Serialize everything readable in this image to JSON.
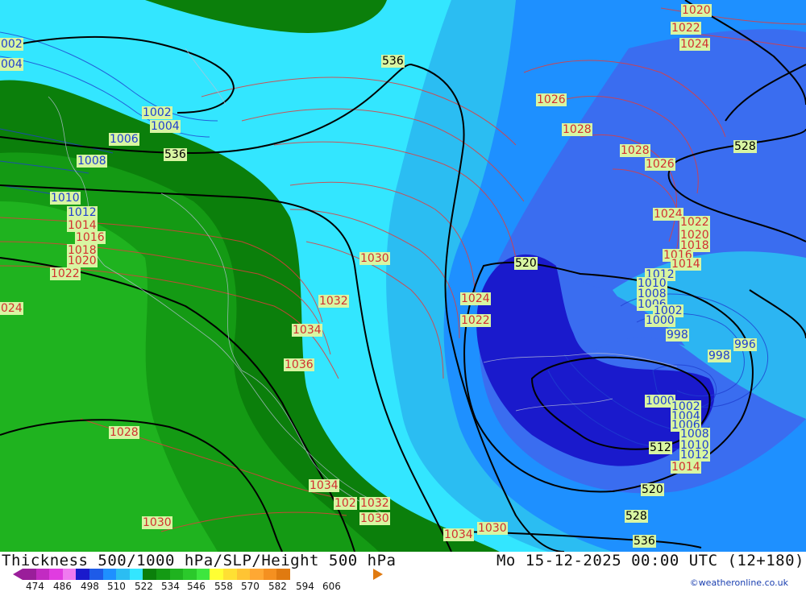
{
  "title": "Thickness 500/1000 hPa/SLP/Height 500 hPa",
  "datetime": "Mo 15-12-2025 00:00 UTC (12+180)",
  "credit": "©weatheronline.co.uk",
  "colors": {
    "band_green_dark": "#0b7f0b",
    "band_green_mid": "#149a14",
    "band_green": "#1fb31f",
    "band_cyan": "#33e6ff",
    "band_sky": "#2bbdf2",
    "band_blue": "#1e90ff",
    "band_mid_blue": "#3a6df0",
    "band_deep_blue": "#1a1acc",
    "slp_high": "#e03c3c",
    "slp_low": "#1f3fd0",
    "height": "#000000",
    "label_fill": "#d8f5a2"
  },
  "scale": {
    "ticks": [
      "474",
      "486",
      "498",
      "510",
      "522",
      "534",
      "546",
      "558",
      "570",
      "582",
      "594",
      "606"
    ],
    "colors": [
      "#9a1e9a",
      "#c22bc2",
      "#e03ce0",
      "#f07af0",
      "#1a1acc",
      "#1e5be8",
      "#1e90ff",
      "#2bbdf2",
      "#33e6ff",
      "#0b7f0b",
      "#149a14",
      "#1fb31f",
      "#2bc92b",
      "#3ee63e",
      "#ffff33",
      "#ffe033",
      "#ffc433",
      "#ffa833",
      "#f59020",
      "#e07a10"
    ]
  },
  "labels": [
    {
      "text": "1020",
      "c": "r"
    },
    {
      "text": "1022",
      "c": "r"
    },
    {
      "text": "1024",
      "c": "r"
    },
    {
      "text": "002",
      "c": "b"
    },
    {
      "text": "004",
      "c": "b"
    },
    {
      "text": "1002",
      "c": "b"
    },
    {
      "text": "1004",
      "c": "b"
    },
    {
      "text": "1006",
      "c": "b"
    },
    {
      "text": "1008",
      "c": "b"
    },
    {
      "text": "536",
      "c": "k"
    },
    {
      "text": "536",
      "c": "k"
    },
    {
      "text": "1026",
      "c": "r"
    },
    {
      "text": "1028",
      "c": "r"
    },
    {
      "text": "1028",
      "c": "r"
    },
    {
      "text": "1026",
      "c": "r"
    },
    {
      "text": "528",
      "c": "k"
    },
    {
      "text": "1010",
      "c": "b"
    },
    {
      "text": "1012",
      "c": "b"
    },
    {
      "text": "1014",
      "c": "r"
    },
    {
      "text": "1016",
      "c": "r"
    },
    {
      "text": "1018",
      "c": "r"
    },
    {
      "text": "1020",
      "c": "r"
    },
    {
      "text": "1022",
      "c": "r"
    },
    {
      "text": "1024",
      "c": "r"
    },
    {
      "text": "1022",
      "c": "r"
    },
    {
      "text": "1020",
      "c": "r"
    },
    {
      "text": "1018",
      "c": "r"
    },
    {
      "text": "1016",
      "c": "r"
    },
    {
      "text": "1014",
      "c": "r"
    },
    {
      "text": "1030",
      "c": "r"
    },
    {
      "text": "520",
      "c": "k"
    },
    {
      "text": "1012",
      "c": "b"
    },
    {
      "text": "1010",
      "c": "b"
    },
    {
      "text": "1008",
      "c": "b"
    },
    {
      "text": "1006",
      "c": "b"
    },
    {
      "text": "1032",
      "c": "r"
    },
    {
      "text": "1024",
      "c": "r"
    },
    {
      "text": "1002",
      "c": "b"
    },
    {
      "text": "1000",
      "c": "b"
    },
    {
      "text": "024",
      "c": "r"
    },
    {
      "text": "1022",
      "c": "r"
    },
    {
      "text": "1034",
      "c": "r"
    },
    {
      "text": "998",
      "c": "b"
    },
    {
      "text": "996",
      "c": "b"
    },
    {
      "text": "998",
      "c": "b"
    },
    {
      "text": "1036",
      "c": "r"
    },
    {
      "text": "1000",
      "c": "b"
    },
    {
      "text": "1002",
      "c": "b"
    },
    {
      "text": "1004",
      "c": "b"
    },
    {
      "text": "1006",
      "c": "b"
    },
    {
      "text": "1008",
      "c": "b"
    },
    {
      "text": "1010",
      "c": "b"
    },
    {
      "text": "1012",
      "c": "b"
    },
    {
      "text": "512",
      "c": "k"
    },
    {
      "text": "1014",
      "c": "r"
    },
    {
      "text": "1028",
      "c": "r"
    },
    {
      "text": "520",
      "c": "k"
    },
    {
      "text": "1034",
      "c": "r"
    },
    {
      "text": "1032",
      "c": "r"
    },
    {
      "text": "102",
      "c": "r"
    },
    {
      "text": "1030",
      "c": "r"
    },
    {
      "text": "528",
      "c": "k"
    },
    {
      "text": "1030",
      "c": "r"
    },
    {
      "text": "1030",
      "c": "r"
    },
    {
      "text": "1034",
      "c": "r"
    },
    {
      "text": "536",
      "c": "k"
    }
  ]
}
